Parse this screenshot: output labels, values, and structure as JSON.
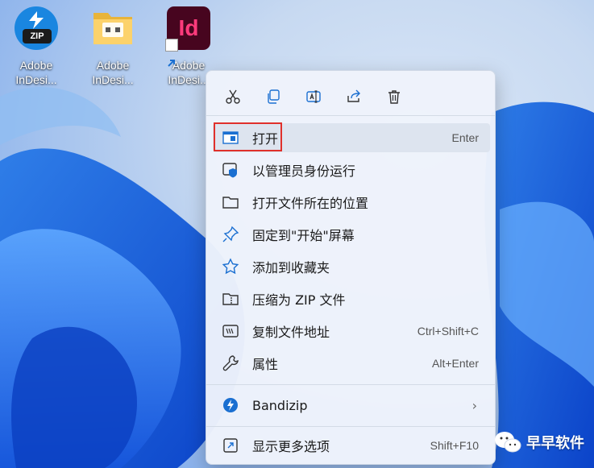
{
  "desktop": {
    "icons": [
      {
        "line1": "Adobe",
        "line2": "InDesi...",
        "type": "zip",
        "badge": "ZIP"
      },
      {
        "line1": "Adobe",
        "line2": "InDesi...",
        "type": "folder"
      },
      {
        "line1": "Adobe",
        "line2": "InDesi...",
        "type": "indesign",
        "glyph": "Id"
      }
    ]
  },
  "context_menu": {
    "toolbar": [
      "cut-icon",
      "copy-icon",
      "rename-icon",
      "share-icon",
      "delete-icon"
    ],
    "items": [
      {
        "label": "打开",
        "shortcut": "Enter",
        "icon": "open-window-icon"
      },
      {
        "label": "以管理员身份运行",
        "shortcut": "",
        "icon": "admin-shield-icon"
      },
      {
        "label": "打开文件所在的位置",
        "shortcut": "",
        "icon": "folder-icon"
      },
      {
        "label": "固定到\"开始\"屏幕",
        "shortcut": "",
        "icon": "pin-icon"
      },
      {
        "label": "添加到收藏夹",
        "shortcut": "",
        "icon": "star-icon"
      },
      {
        "label": "压缩为 ZIP 文件",
        "shortcut": "",
        "icon": "zip-folder-icon"
      },
      {
        "label": "复制文件地址",
        "shortcut": "Ctrl+Shift+C",
        "icon": "copy-path-icon"
      },
      {
        "label": "属性",
        "shortcut": "Alt+Enter",
        "icon": "wrench-icon"
      }
    ],
    "bandizip": {
      "label": "Bandizip",
      "icon": "bandizip-icon"
    },
    "more": {
      "label": "显示更多选项",
      "shortcut": "Shift+F10",
      "icon": "more-options-icon"
    }
  },
  "watermark": {
    "text": "早早软件"
  },
  "colors": {
    "accent": "#1a86e0",
    "highlight_border": "#e0302b",
    "indesign_bg": "#47051f",
    "indesign_fg": "#ff3b7c"
  }
}
